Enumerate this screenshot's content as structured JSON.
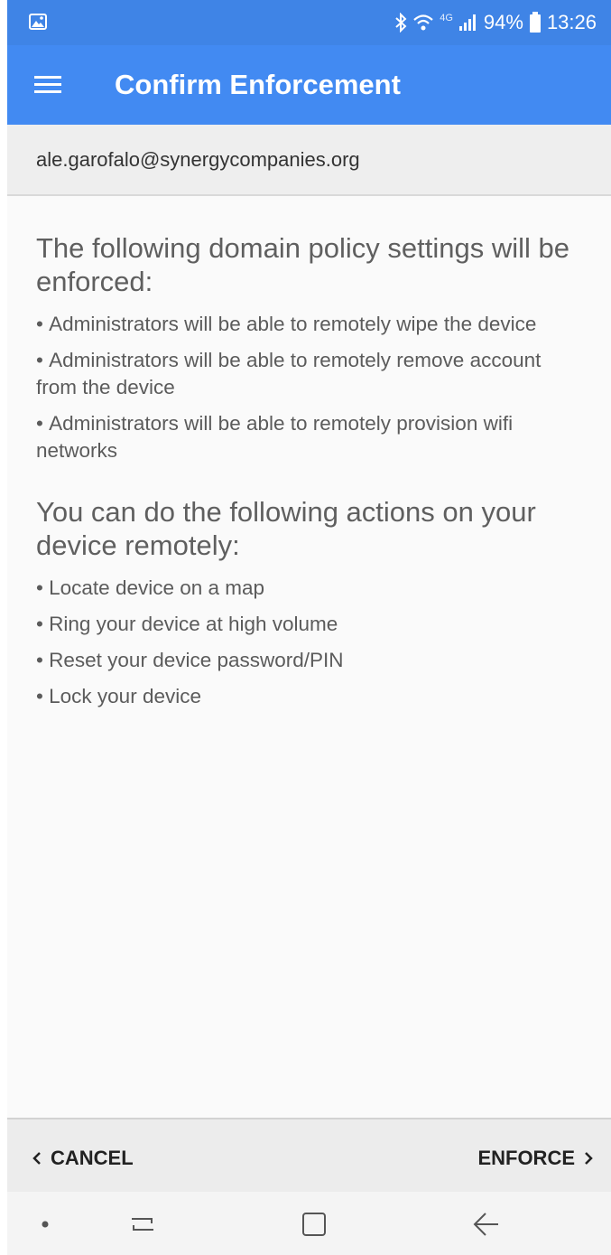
{
  "status_bar": {
    "battery_percent": "94%",
    "network_label": "4G",
    "time": "13:26",
    "icons": [
      "image-icon",
      "bluetooth-icon",
      "wifi-icon",
      "signal-icon",
      "battery-icon"
    ]
  },
  "app_bar": {
    "title": "Confirm Enforcement",
    "menu_icon": "hamburger-menu-icon"
  },
  "account": {
    "email": "ale.garofalo@synergycompanies.org"
  },
  "policies": {
    "heading": "The following domain policy settings will be enforced:",
    "items": [
      "Administrators will be able to remotely wipe the device",
      "Administrators will be able to remotely remove account from the device",
      "Administrators will be able to remotely provision wifi networks"
    ]
  },
  "actions": {
    "heading": "You can do the following actions on your device remotely:",
    "items": [
      "Locate device on a map",
      "Ring your device at high volume",
      "Reset your device password/PIN",
      "Lock your device"
    ]
  },
  "bottom_bar": {
    "cancel_label": "CANCEL",
    "enforce_label": "ENFORCE"
  },
  "colors": {
    "status_bar": "#3f84e6",
    "app_bar": "#428af2",
    "background": "#fafafa",
    "text": "#5b5b5b"
  }
}
